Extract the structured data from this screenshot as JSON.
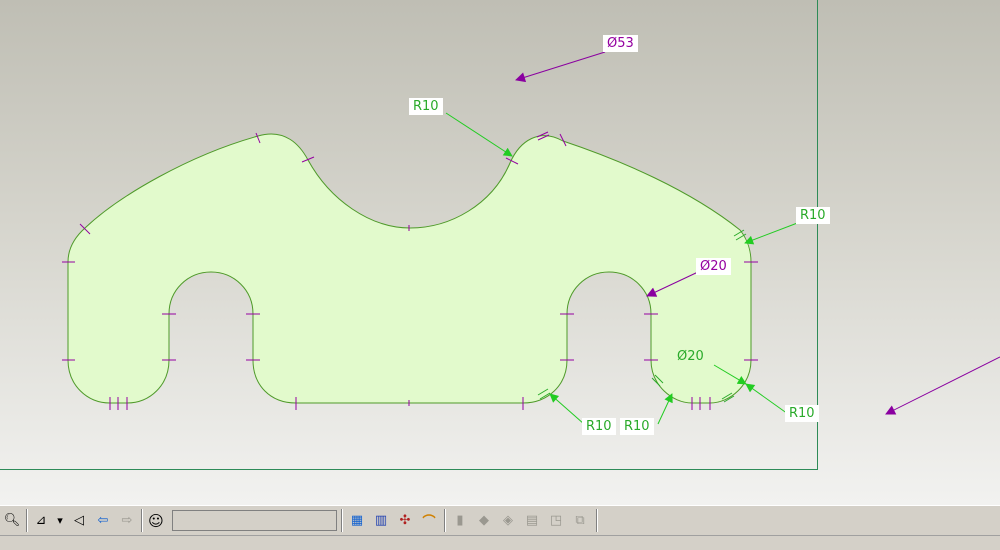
{
  "window": {
    "title": ""
  },
  "dimensions": {
    "d53": "Ø53",
    "r10_top": "R10",
    "r10_right": "R10",
    "d20_right": "Ø20",
    "d20_lower": "Ø20",
    "r10_bottom_a": "R10",
    "r10_bottom_b": "R10",
    "r10_bottom_c": "R10"
  },
  "colors": {
    "part_fill": "#e2facc",
    "part_edge": "#4f9a2a",
    "dim_green": "#2aaa2a",
    "dim_purple": "#9400a0",
    "sheet_border": "#2e8b57"
  },
  "toolbar": {
    "left_tools": [
      {
        "name": "zoom-out-icon",
        "glyph": "🔍︎"
      },
      {
        "name": "sketch-plane-icon",
        "glyph": "⊿"
      },
      {
        "name": "dropdown-arrow-icon",
        "glyph": "▾"
      },
      {
        "name": "view-orient-icon",
        "glyph": "◁"
      },
      {
        "name": "previous-view-icon",
        "glyph": "⇦"
      },
      {
        "name": "next-view-icon",
        "glyph": "⇨"
      },
      {
        "name": "smiley-icon",
        "glyph": "☺"
      }
    ],
    "right_tools": [
      {
        "name": "shaded-block-icon",
        "glyph": "▦"
      },
      {
        "name": "feature-tool-icon",
        "glyph": "▥"
      },
      {
        "name": "datum-axis-icon",
        "glyph": "✣"
      },
      {
        "name": "pipe-sweep-icon",
        "glyph": "⌒"
      },
      {
        "name": "disabled-tool-1-icon",
        "glyph": "▮"
      },
      {
        "name": "disabled-tool-2-icon",
        "glyph": "◆"
      },
      {
        "name": "disabled-tool-3-icon",
        "glyph": "◈"
      },
      {
        "name": "disabled-tool-4-icon",
        "glyph": "▤"
      },
      {
        "name": "disabled-tool-5-icon",
        "glyph": "◳"
      },
      {
        "name": "disabled-tool-6-icon",
        "glyph": "⧉"
      }
    ]
  }
}
